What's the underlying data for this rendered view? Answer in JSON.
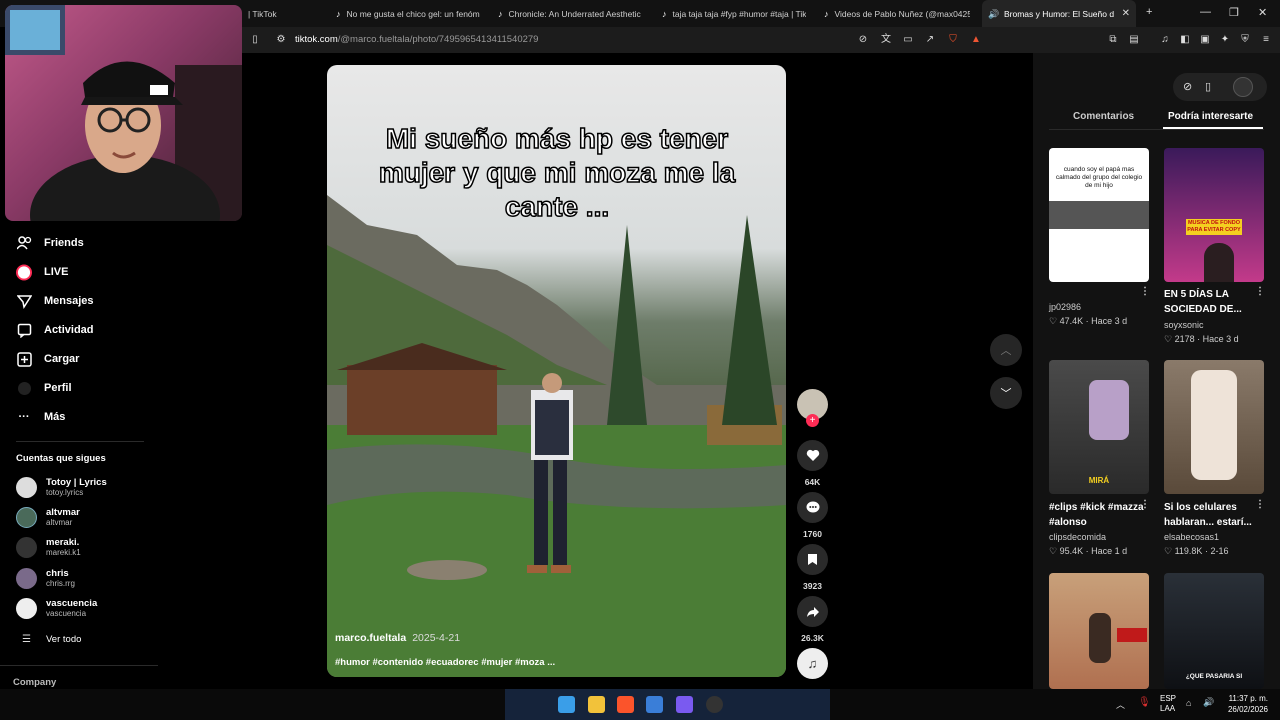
{
  "tabs": [
    {
      "label": "| TikTok"
    },
    {
      "label": "No me gusta el chico gel: un fenóm"
    },
    {
      "label": "Chronicle: An Underrated Aesthetic"
    },
    {
      "label": "taja taja taja #fyp #humor #taja | Tik"
    },
    {
      "label": "Videos de Pablo Nuñez (@max0425"
    },
    {
      "label": "Bromas y Humor: El Sueño d"
    }
  ],
  "address": {
    "domain": "tiktok.com",
    "path": "/@marco.fueltala/photo/7495965413411540279"
  },
  "sidebar": {
    "nav": [
      {
        "label": "Friends"
      },
      {
        "label": "LIVE"
      },
      {
        "label": "Mensajes"
      },
      {
        "label": "Actividad"
      },
      {
        "label": "Cargar"
      },
      {
        "label": "Perfil"
      },
      {
        "label": "Más"
      }
    ],
    "following_title": "Cuentas que sigues",
    "accounts": [
      {
        "name": "Totoy | Lyrics",
        "handle": "totoy.lyrics"
      },
      {
        "name": "altvmar",
        "handle": "altvmar"
      },
      {
        "name": "meraki.",
        "handle": "mareki.k1"
      },
      {
        "name": "chris",
        "handle": "chris.rrg"
      },
      {
        "name": "vascuencia",
        "handle": "vascuencia"
      }
    ],
    "see_all": "Ver todo",
    "company": "Company"
  },
  "video": {
    "caption": "Mi sueño más hp es tener mujer y que mi moza me la cante ...",
    "author": "marco.fueltala",
    "date": "2025-4-21",
    "tags": "#humor #contenido #ecuadorec #mujer #moza ..."
  },
  "actions": {
    "likes": "64K",
    "comments": "1760",
    "saves": "3923",
    "shares": "26.3K"
  },
  "right_panel": {
    "tabs": [
      {
        "label": "Comentarios"
      },
      {
        "label": "Podría interesarte"
      }
    ],
    "cards": [
      {
        "title": "",
        "user": "jp02986",
        "likes": "47.4K",
        "time": "Hace 3 d",
        "overlay": "cuando soy el papá  mas calmado del grupo del colegio de mi hijo"
      },
      {
        "title": "EN 5 DÍAS LA SOCIEDAD DE...",
        "user": "soyxsonic",
        "likes": "2178",
        "time": "Hace 3 d",
        "overlay": "MUSICA DE FONDO PARA EVITAR COPY"
      },
      {
        "title": "#clips #kick #mazza #alonso",
        "user": "clipsdecomida",
        "likes": "95.4K",
        "time": "Hace 1 d",
        "overlay": "MIRÁ"
      },
      {
        "title": "Si los celulares hablaran... estarí...",
        "user": "elsabecosas1",
        "likes": "119.8K",
        "time": "2-16",
        "overlay": ""
      },
      {
        "title": "",
        "user": "",
        "likes": "",
        "time": "",
        "overlay": ""
      },
      {
        "title": "",
        "user": "",
        "likes": "",
        "time": "",
        "overlay": "¿QUE PASARIA SI"
      }
    ]
  },
  "taskbar": {
    "lang": "ESP",
    "lang2": "LAA",
    "time": "11:37 p. m.",
    "date": "26/02/2026"
  }
}
